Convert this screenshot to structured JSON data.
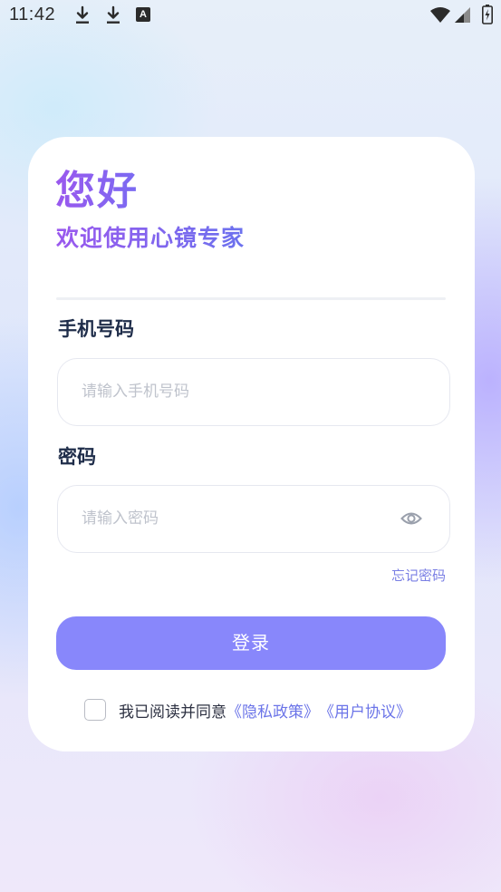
{
  "status_bar": {
    "time": "11:42",
    "notification_letter": "A"
  },
  "card": {
    "greeting": "您好",
    "welcome": "欢迎使用心镜专家",
    "phone": {
      "label": "手机号码",
      "placeholder": "请输入手机号码",
      "value": ""
    },
    "password": {
      "label": "密码",
      "placeholder": "请输入密码",
      "value": ""
    },
    "forgot_password": "忘记密码",
    "login_button": "登录",
    "agreement": {
      "checked": false,
      "text": "我已阅读并同意",
      "privacy_link": "《隐私政策》",
      "terms_link": "《用户协议》"
    }
  },
  "colors": {
    "accent": "#8887fb",
    "title_gradient_start": "#9a58ee",
    "title_gradient_end": "#6c72ee",
    "link": "#6b74e8",
    "label": "#1f2d4a"
  }
}
